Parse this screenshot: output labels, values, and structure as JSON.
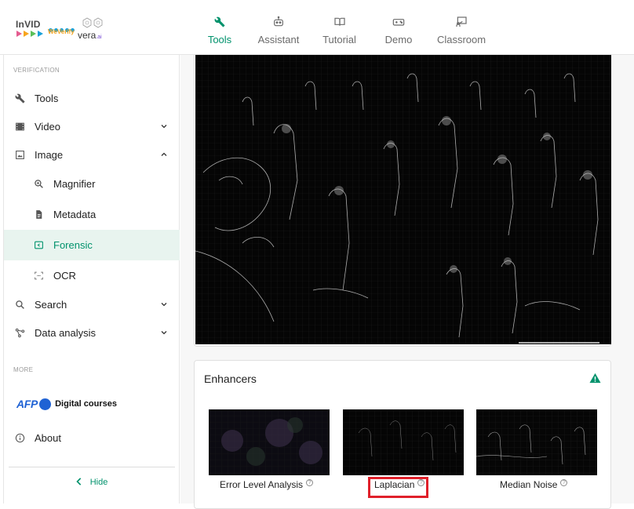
{
  "brand": {
    "invid": "InVID",
    "weverify": "WeVerify",
    "vera": "vera",
    "vera_suffix": ".ai"
  },
  "top_nav": [
    {
      "label": "Tools",
      "icon": "wrench-icon",
      "active": true
    },
    {
      "label": "Assistant",
      "icon": "robot-icon",
      "active": false
    },
    {
      "label": "Tutorial",
      "icon": "book-icon",
      "active": false
    },
    {
      "label": "Demo",
      "icon": "gamepad-icon",
      "active": false
    },
    {
      "label": "Classroom",
      "icon": "classroom-icon",
      "active": false
    }
  ],
  "sidebar": {
    "section_verification": "VERIFICATION",
    "items": {
      "tools": "Tools",
      "video": "Video",
      "image": "Image",
      "magnifier": "Magnifier",
      "metadata": "Metadata",
      "forensic": "Forensic",
      "ocr": "OCR",
      "search": "Search",
      "data_analysis": "Data analysis"
    },
    "section_more": "MORE",
    "afp_logo": "AFP",
    "digital_courses": "Digital courses",
    "about": "About",
    "hide": "Hide"
  },
  "enhancers": {
    "title": "Enhancers",
    "filters": [
      {
        "label": "Error Level Analysis",
        "help": "?"
      },
      {
        "label": "Laplacian",
        "help": "?"
      },
      {
        "label": "Median Noise",
        "help": "?"
      }
    ]
  },
  "colors": {
    "accent": "#00926c",
    "selected_bg": "#e8f4ef",
    "highlight": "#e0202a",
    "afp_blue": "#1f62d4"
  }
}
